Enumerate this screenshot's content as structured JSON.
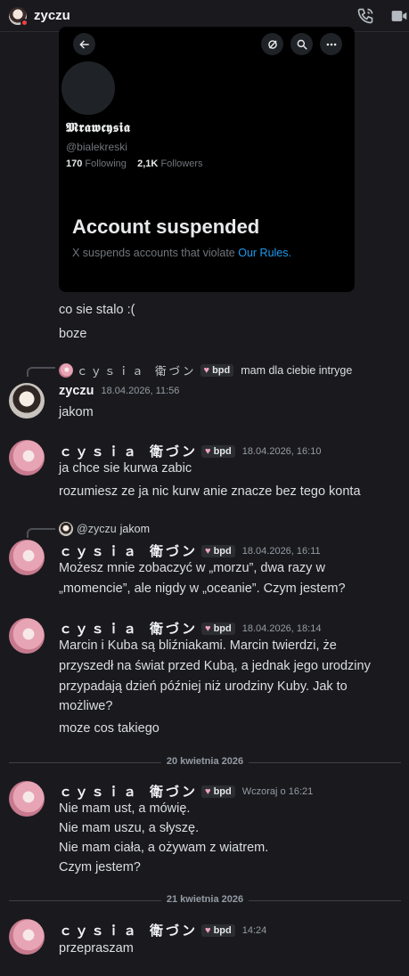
{
  "header": {
    "username": "zyczu",
    "icons": [
      "phone-icon",
      "video-icon"
    ]
  },
  "embed": {
    "display_name": "𝕸𝖗𝖆𝖜𝖈𝖞𝖘𝖎𝖆",
    "handle": "@bialekreski",
    "following_count": "170",
    "following_label": "Following",
    "followers_count": "2,1K",
    "followers_label": "Followers",
    "suspended_title": "Account suspended",
    "suspended_text": "X suspends accounts that violate ",
    "suspended_link": "Our Rules."
  },
  "messages": {
    "m1": "co sie stalo :(",
    "m2": "boze",
    "reply1": {
      "name": "ｃｙｓｉａ 衛づン",
      "badge": "bpd",
      "text": "mam dla ciebie intryge"
    },
    "zyczu": {
      "name": "zyczu",
      "time": "18.04.2026, 11:56",
      "text": "jakom"
    },
    "cysia1": {
      "name": "ｃｙｓｉａ 衛づン",
      "badge": "bpd",
      "time": "18.04.2026, 16:10",
      "lines": [
        "ja chce sie kurwa zabic",
        "rozumiesz ze ja nic kurw anie znacze bez tego konta"
      ]
    },
    "reply2": {
      "name": "@zyczu",
      "text": "jakom"
    },
    "cysia2": {
      "name": "ｃｙｓｉａ 衛づン",
      "badge": "bpd",
      "time": "18.04.2026, 16:11",
      "lines": [
        "Możesz mnie zobaczyć w „morzu”, dwa razy w",
        "„momencie”, ale nigdy w „oceanie”. Czym jestem?"
      ]
    },
    "cysia3": {
      "name": "ｃｙｓｉａ 衛づン",
      "badge": "bpd",
      "time": "18.04.2026, 18:14",
      "lines": [
        "Marcin i Kuba są bliźniakami. Marcin twierdzi, że",
        "przyszedł na świat przed Kubą, a jednak jego urodziny",
        "przypadają dzień później niż urodziny Kuby. Jak to",
        "możliwe?",
        "moze cos takiego"
      ]
    },
    "divider1": "20 kwietnia 2026",
    "cysia4": {
      "name": "ｃｙｓｉａ 衛づン",
      "badge": "bpd",
      "time": "Wczoraj o 16:21",
      "lines": [
        "Nie mam ust, a mówię.",
        "Nie mam uszu, a słyszę.",
        "Nie mam ciała, a ożywam z wiatrem.",
        "Czym jestem?"
      ]
    },
    "divider2": "21 kwietnia 2026",
    "cysia5": {
      "name": "ｃｙｓｉａ 衛づン",
      "badge": "bpd",
      "time": "14:24",
      "lines": [
        "przepraszam"
      ]
    }
  }
}
